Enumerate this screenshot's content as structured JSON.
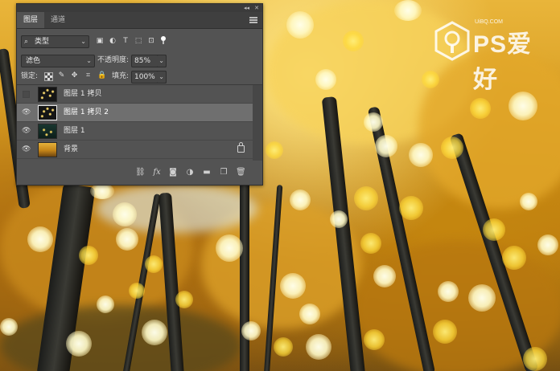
{
  "panel": {
    "tabs": [
      {
        "label": "图层",
        "active": true
      },
      {
        "label": "通道",
        "active": false
      }
    ],
    "filter": {
      "kind_label": "类型",
      "icons": [
        "image-filter-icon",
        "adjustment-filter-icon",
        "text-filter-icon",
        "shape-filter-icon",
        "smart-object-filter-icon"
      ],
      "icon_glyphs": [
        "▣",
        "◐",
        "T",
        "⬚",
        "⊡"
      ]
    },
    "blend": {
      "mode": "滤色",
      "opacity_label": "不透明度:",
      "opacity_value": "85%"
    },
    "lock": {
      "label": "锁定:",
      "fill_label": "填充:",
      "fill_value": "100%",
      "icon_glyphs": [
        "✎",
        "✥",
        "⌗",
        "🔒"
      ]
    },
    "layers": [
      {
        "name": "图层 1 拷贝",
        "visible": false,
        "selected": false,
        "thumb": "dark"
      },
      {
        "name": "图层 1 拷贝 2",
        "visible": true,
        "selected": true,
        "thumb": "dark"
      },
      {
        "name": "图层 1",
        "visible": true,
        "selected": false,
        "thumb": "dark-green"
      },
      {
        "name": "背景",
        "visible": true,
        "selected": false,
        "thumb": "photo",
        "locked": true
      }
    ],
    "bottom_icons": [
      {
        "name": "link-layers-icon",
        "glyph": "⛓"
      },
      {
        "name": "layer-style-icon",
        "glyph": "fx"
      },
      {
        "name": "add-mask-icon",
        "glyph": "◙"
      },
      {
        "name": "adjustment-layer-icon",
        "glyph": "◑"
      },
      {
        "name": "new-group-icon",
        "glyph": "▬"
      },
      {
        "name": "new-layer-icon",
        "glyph": "❐"
      },
      {
        "name": "delete-layer-icon",
        "glyph": "🗑"
      }
    ]
  },
  "watermark": {
    "text": "PS爱好",
    "url": "UiBQ.COM"
  }
}
